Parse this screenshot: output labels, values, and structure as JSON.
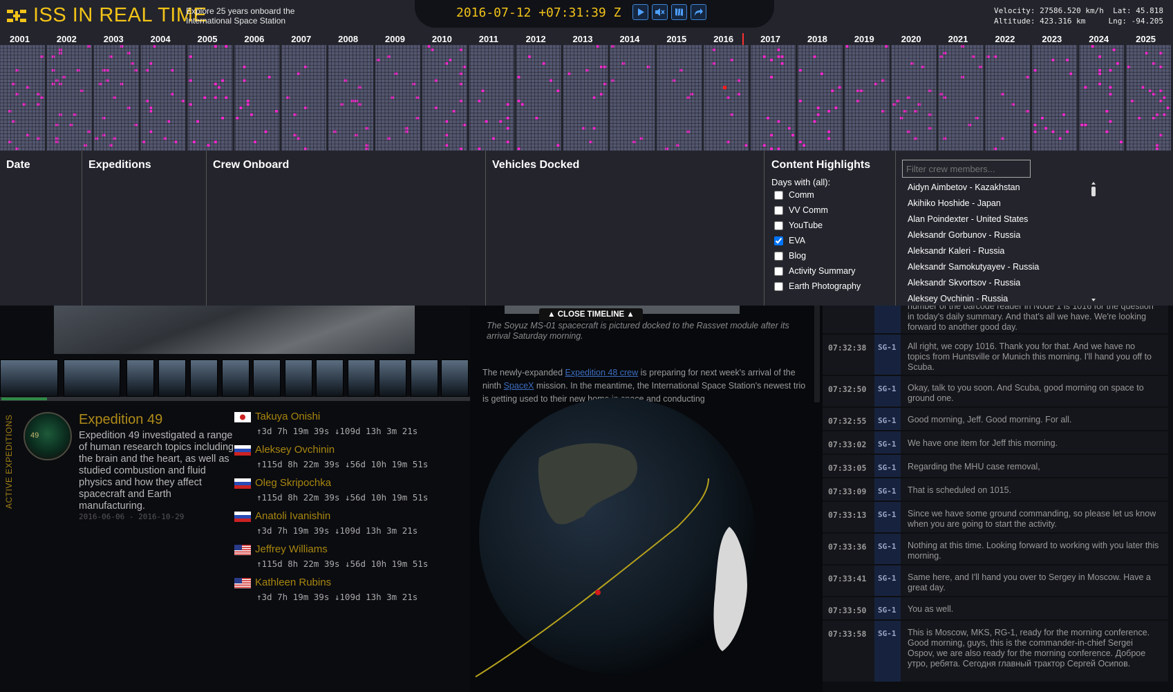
{
  "header": {
    "title": "ISS IN REAL TIME",
    "tagline": "Explore 25 years onboard the International Space Station",
    "clock": "2016-07-12 +07:31:39 Z",
    "controls": [
      "play-icon",
      "mute-icon",
      "map-icon",
      "share-icon"
    ],
    "telemetry": {
      "row1": "Velocity: 27586.520 km/h  Lat: 45.818",
      "row2": "Altitude: 423.316 km     Lng: -94.205"
    }
  },
  "timeline": {
    "years": [
      "2001",
      "2002",
      "2003",
      "2004",
      "2005",
      "2006",
      "2007",
      "2008",
      "2009",
      "2010",
      "2011",
      "2012",
      "2013",
      "2014",
      "2015",
      "2016",
      "2017",
      "2018",
      "2019",
      "2020",
      "2021",
      "2022",
      "2023",
      "2024",
      "2025"
    ],
    "current_year": "2016",
    "highlight_color": "#ff2ad4",
    "cell_color": "#64677f"
  },
  "info": {
    "date_header": "Date",
    "expeditions_header": "Expeditions",
    "crew_header": "Crew Onboard",
    "vehicles_header": "Vehicles Docked",
    "content_header": "Content Highlights",
    "days_with": "Days with (all):",
    "filters": [
      {
        "label": "Comm",
        "checked": false
      },
      {
        "label": "VV Comm",
        "checked": false
      },
      {
        "label": "YouTube",
        "checked": false
      },
      {
        "label": "EVA",
        "checked": true
      },
      {
        "label": "Blog",
        "checked": false
      },
      {
        "label": "Activity Summary",
        "checked": false
      },
      {
        "label": "Earth Photography",
        "checked": false
      }
    ],
    "crew_filter_placeholder": "Filter crew members...",
    "crew_list": [
      "Aidyn Aimbetov - Kazakhstan",
      "Akihiko Hoshide - Japan",
      "Alan Poindexter - United States",
      "Aleksandr Gorbunov - Russia",
      "Aleksandr Kaleri - Russia",
      "Aleksandr Samokutyayev - Russia",
      "Aleksandr Skvortsov - Russia",
      "Aleksey Ovchinin - Russia"
    ]
  },
  "expedition": {
    "side_label": "ACTIVE EXPEDITIONS",
    "patch_number": "49",
    "title": "Expedition 49",
    "description": "Expedition 49 investigated a range of human research topics including the brain and the heart, as well as studied combustion and fluid physics and how they affect spacecraft and Earth manufacturing.",
    "dates": "2016-06-06 - 2016-10-29",
    "crew": [
      {
        "name": "Takuya Onishi",
        "flag": "japan",
        "times": "↑3d 7h 19m 39s ↓109d 13h 3m 21s"
      },
      {
        "name": "Aleksey Ovchinin",
        "flag": "russia",
        "times": "↑115d 8h 22m 39s ↓56d 10h 19m 51s"
      },
      {
        "name": "Oleg Skripochka",
        "flag": "russia",
        "times": "↑115d 8h 22m 39s ↓56d 10h 19m 51s"
      },
      {
        "name": "Anatoli Ivanishin",
        "flag": "russia",
        "times": "↑3d 7h 19m 39s ↓109d 13h 3m 21s"
      },
      {
        "name": "Jeffrey Williams",
        "flag": "usa",
        "times": "↑115d 8h 22m 39s ↓56d 10h 19m 51s"
      },
      {
        "name": "Kathleen Rubins",
        "flag": "usa",
        "times": "↑3d 7h 19m 39s ↓109d 13h 3m 21s"
      }
    ]
  },
  "article": {
    "close_timeline": "CLOSE TIMELINE",
    "caption": "The Soyuz MS-01 spacecraft is pictured docked to the Rassvet module after its arrival Saturday morning.",
    "body_pre": "The newly-expanded ",
    "link1": "Expedition 48 crew",
    "body_mid": " is preparing for next week's arrival of the ninth ",
    "link2": "SpaceX",
    "body_post": " mission. In the meantime, the International Space Station's newest trio is getting used to their new home in space and conducting"
  },
  "transcript": [
    {
      "time": "",
      "badge": "",
      "text": "number of the barcode reader in Node 1 is 1016 for the question in today's daily summary. And that's all we have. We're looking forward to another good day."
    },
    {
      "time": "07:32:38",
      "badge": "SG-1",
      "text": "All right, we copy 1016. Thank you for that. And we have no topics from Huntsville or Munich this morning. I'll hand you off to Scuba."
    },
    {
      "time": "07:32:50",
      "badge": "SG-1",
      "text": "Okay, talk to you soon. And Scuba, good morning on space to ground one."
    },
    {
      "time": "07:32:55",
      "badge": "SG-1",
      "text": "Good morning, Jeff. Good morning. For all."
    },
    {
      "time": "07:33:02",
      "badge": "SG-1",
      "text": "We have one item for Jeff this morning."
    },
    {
      "time": "07:33:05",
      "badge": "SG-1",
      "text": "Regarding the MHU case removal,"
    },
    {
      "time": "07:33:09",
      "badge": "SG-1",
      "text": "That is scheduled on 1015."
    },
    {
      "time": "07:33:13",
      "badge": "SG-1",
      "text": "Since we have some ground commanding, so please let us know when you are going to start the activity."
    },
    {
      "time": "07:33:36",
      "badge": "SG-1",
      "text": "Nothing at this time. Looking forward to working with you later this morning."
    },
    {
      "time": "07:33:41",
      "badge": "SG-1",
      "text": "Same here, and I'll hand you over to Sergey in Moscow. Have a great day."
    },
    {
      "time": "07:33:50",
      "badge": "SG-1",
      "text": "You as well."
    },
    {
      "time": "07:33:58",
      "badge": "SG-1",
      "text": "This is Moscow, MKS, RG-1, ready for the morning conference. Good morning, guys, this is the commander-in-chief Sergei Ospov, we are also ready for the morning conference. Доброе утро, ребята. Сегодня главный трактор Сергей Осипов."
    }
  ]
}
